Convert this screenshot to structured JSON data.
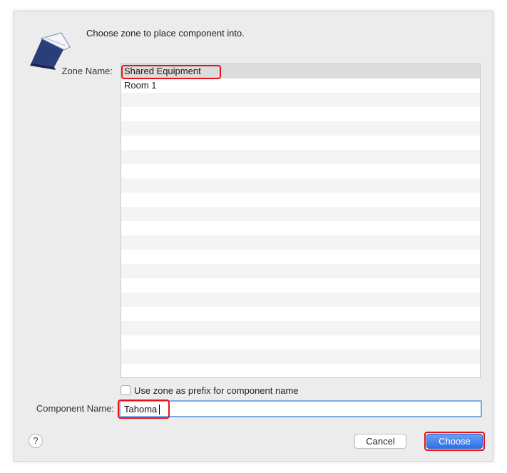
{
  "dialog": {
    "message": "Choose zone to place component into.",
    "zone_label": "Zone Name:",
    "zones": [
      "Shared Equipment",
      "Room 1"
    ],
    "selected_zone": "Shared Equipment",
    "checkbox_label": "Use zone as prefix for component name",
    "checkbox_checked": false,
    "component_label": "Component Name:",
    "component_value": "Tahoma",
    "help_label": "?",
    "cancel_label": "Cancel",
    "choose_label": "Choose"
  },
  "icons": {
    "app": "app-document-icon",
    "help": "help-icon"
  },
  "colors": {
    "highlight": "#e8111b",
    "primary_button": "#2f6fe6",
    "focus_ring": "#7aa7e6"
  }
}
